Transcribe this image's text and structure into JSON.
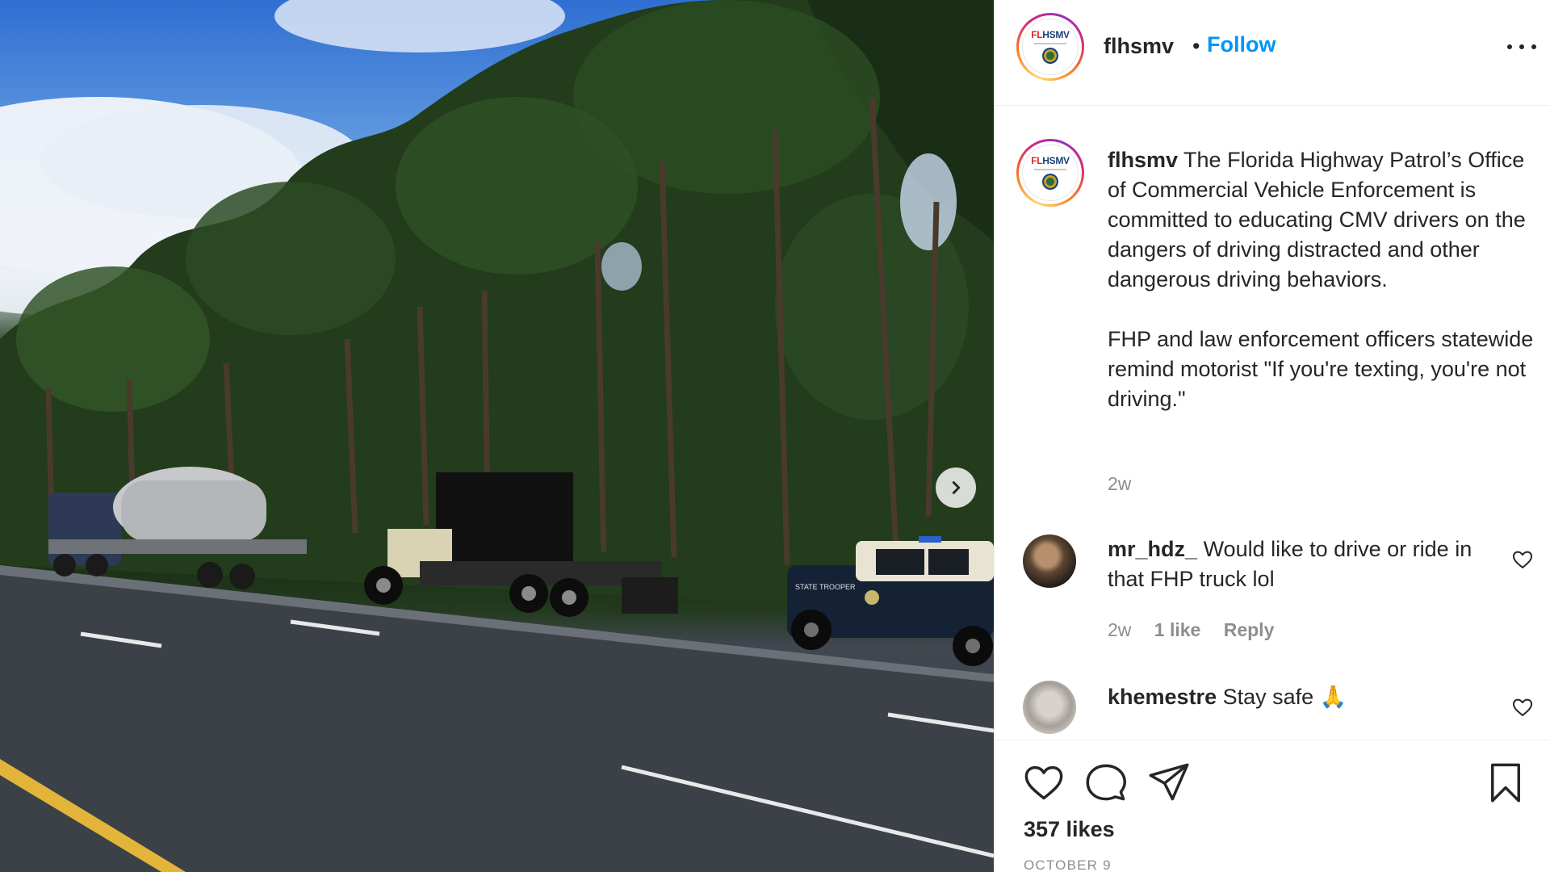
{
  "post": {
    "username": "flhsmv",
    "separator": "•",
    "follow_label": "Follow",
    "more_options_icon": "more-horizontal-icon",
    "avatar": {
      "logo_fl": "FL",
      "logo_hsmv": "HSMV"
    }
  },
  "caption": {
    "username": "flhsmv",
    "text_1": "The Florida Highway Patrol’s Office of Commercial Vehicle Enforcement is committed to educating CMV drivers on the dangers of driving distracted and other dangerous driving behaviors.",
    "text_2": "FHP and law enforcement officers statewide remind motorist \"If you're texting, you're not driving.\"",
    "age": "2w"
  },
  "comments": [
    {
      "username": "mr_hdz_",
      "text": "Would like to drive or ride in that FHP truck lol",
      "age": "2w",
      "likes": "1 like",
      "reply_label": "Reply"
    },
    {
      "username": "khemestre",
      "text": "Stay safe 🙏"
    }
  ],
  "actions": {
    "like_icon": "heart-icon",
    "comment_icon": "comment-bubble-icon",
    "share_icon": "paper-plane-icon",
    "save_icon": "bookmark-icon"
  },
  "likes_count": "357 likes",
  "date": "OCTOBER 9",
  "photo": {
    "vehicle_text": "STATE TROOPER",
    "next_icon": "chevron-right-icon"
  },
  "colors": {
    "link_blue": "#0095f6",
    "text": "#262626",
    "muted": "#8e8e8e",
    "border": "#efefef"
  }
}
